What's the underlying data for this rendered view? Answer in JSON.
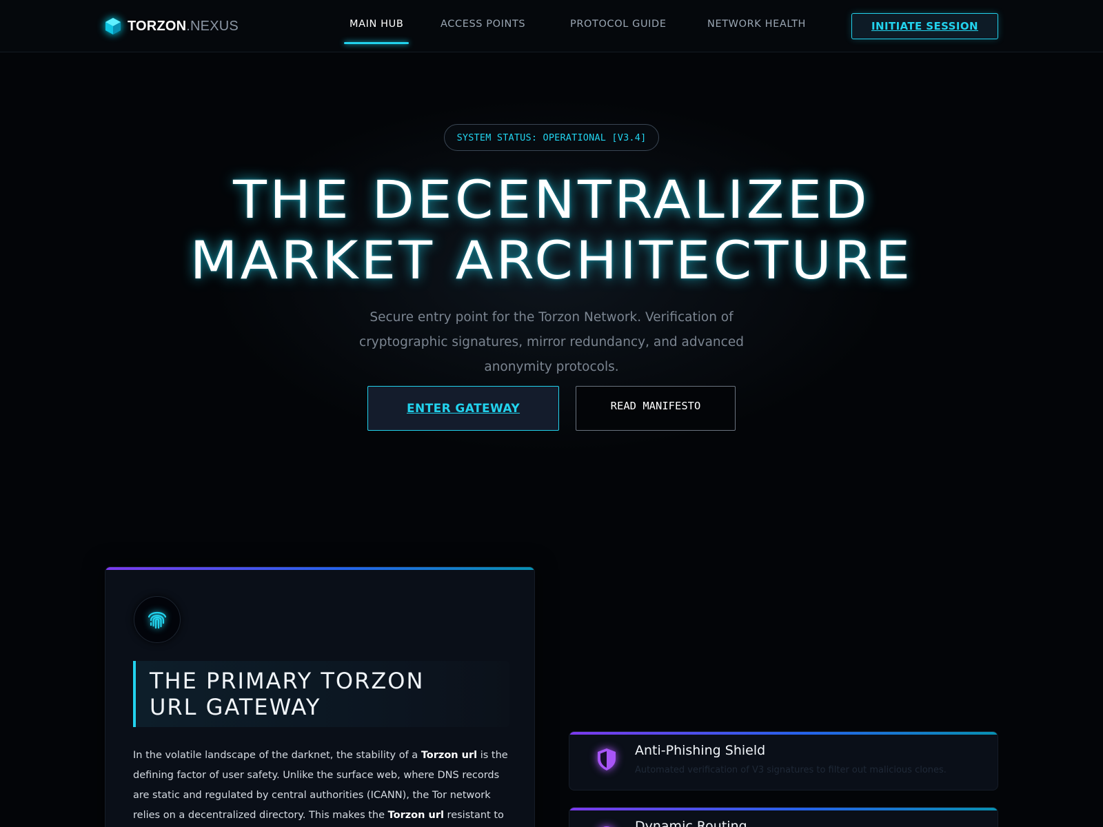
{
  "brand": {
    "name_primary": "TORZON",
    "name_secondary": ".NEXUS",
    "accent_color": "#22d3ee",
    "icon": "cube-icon"
  },
  "nav": {
    "links": [
      {
        "label": "MAIN HUB",
        "active": true
      },
      {
        "label": "ACCESS POINTS",
        "active": false
      },
      {
        "label": "PROTOCOL GUIDE",
        "active": false
      },
      {
        "label": "NETWORK HEALTH",
        "active": false
      }
    ],
    "cta_label": "INITIATE SESSION"
  },
  "hero": {
    "status": "SYSTEM STATUS: OPERATIONAL [V3.4]",
    "title_line1": "THE DECENTRALIZED",
    "title_line2": "MARKET ARCHITECTURE",
    "subtitle": "Secure entry point for the Torzon Network. Verification of cryptographic signatures, mirror redundancy, and advanced anonymity protocols.",
    "primary_button": "ENTER GATEWAY",
    "secondary_button": "READ MANIFESTO"
  },
  "main_card": {
    "icon": "fingerprint-icon",
    "title_line1": "THE PRIMARY TORZON",
    "title_line2": "URL GATEWAY",
    "body": {
      "p1": "In the volatile landscape of the darknet, the stability of a ",
      "b1": "Torzon url",
      "p2": " is the defining factor of user safety. Unlike the surface web, where DNS records are static and regulated by central authorities (ICANN), the Tor network relies on a decentralized directory. This makes the ",
      "b2": "Torzon url",
      "p3": " resistant to"
    }
  },
  "features": [
    {
      "icon": "shield-icon",
      "title": "Anti-Phishing Shield",
      "description": "Automated verification of V3 signatures to filter out malicious clones."
    },
    {
      "icon": "route-icon",
      "title": "Dynamic Routing",
      "description": ""
    }
  ]
}
